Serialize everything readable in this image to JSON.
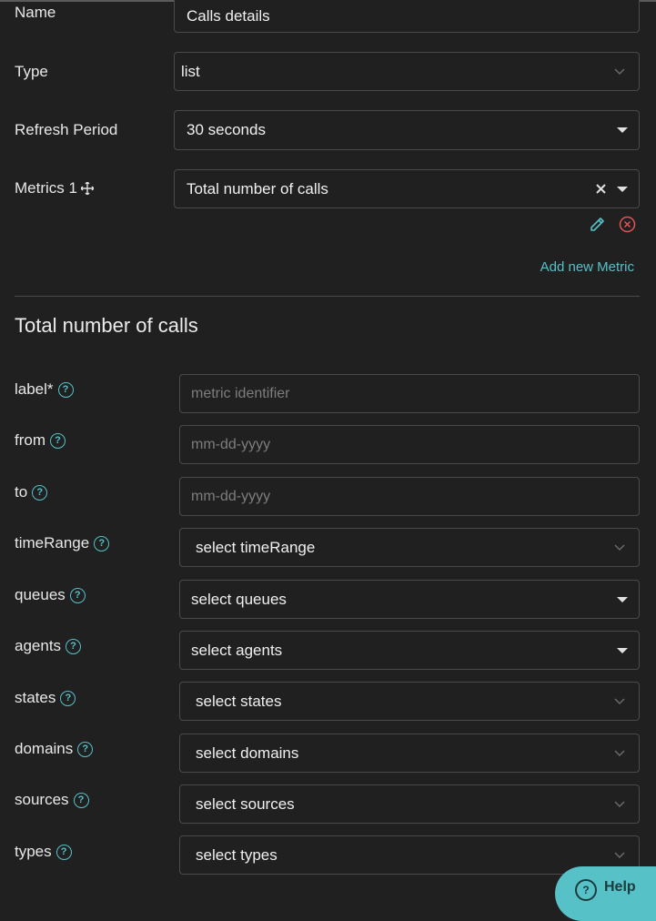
{
  "form": {
    "name_label": "Name",
    "name_value": "Calls details",
    "type_label": "Type",
    "type_value": "list",
    "refresh_label": "Refresh Period",
    "refresh_value": "30 seconds",
    "metrics_label": "Metrics 1",
    "metrics_value": "Total number of calls",
    "add_metric": "Add new Metric"
  },
  "metric_section": {
    "title": "Total number of calls",
    "fields": {
      "label": {
        "label": "label*",
        "placeholder": "metric identifier"
      },
      "from": {
        "label": "from",
        "placeholder": "mm-dd-yyyy"
      },
      "to": {
        "label": "to",
        "placeholder": "mm-dd-yyyy"
      },
      "timeRange": {
        "label": "timeRange",
        "value": "select timeRange"
      },
      "queues": {
        "label": "queues",
        "value": "select queues"
      },
      "agents": {
        "label": "agents",
        "value": "select agents"
      },
      "states": {
        "label": "states",
        "value": "select states"
      },
      "domains": {
        "label": "domains",
        "value": "select domains"
      },
      "sources": {
        "label": "sources",
        "value": "select sources"
      },
      "types": {
        "label": "types",
        "value": "select types"
      }
    }
  },
  "help_button": {
    "label": "Help"
  },
  "colors": {
    "accent": "#56c1c7",
    "danger": "#e05555",
    "background": "#202020"
  }
}
